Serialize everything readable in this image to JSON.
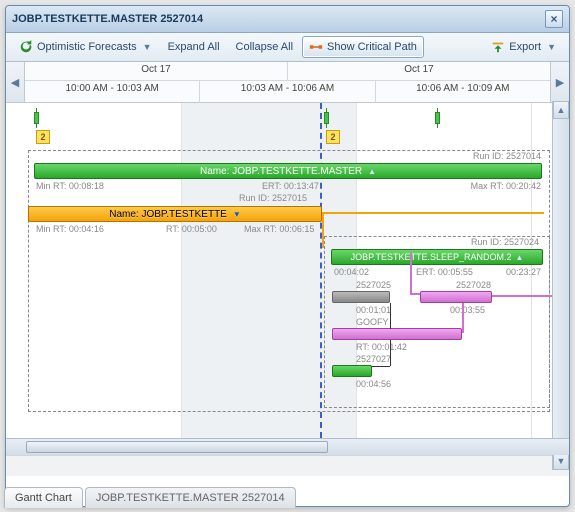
{
  "window": {
    "title": "JOBP.TESTKETTE.MASTER 2527014",
    "close_glyph": "×"
  },
  "toolbar": {
    "optimistic": "Optimistic Forecasts",
    "expand": "Expand All",
    "collapse": "Collapse All",
    "critical": "Show Critical Path",
    "export": "Export"
  },
  "timeline": {
    "top_left": "Oct 17",
    "top_right": "Oct 17",
    "range_left": "10:00 AM - 10:03 AM",
    "range_mid": "10:03 AM - 10:06 AM",
    "range_right": "10:06 AM - 10:09 AM",
    "nav_left": "◀",
    "nav_right": "▶"
  },
  "chart": {
    "badge1": "2",
    "badge2": "2",
    "green1_name": "Name: JOBP.TESTKETTE.MASTER",
    "green1_min": "Min RT: 00:08:18",
    "green1_ert": "ERT: 00:13:47",
    "green1_max": "Max RT: 00:20:42",
    "green1_runid": "Run ID: 2527015",
    "top_runid": "Run ID: 2527014",
    "orange_name": "Name: JOBP.TESTKETTE",
    "orange_min": "Min RT: 00:04:16",
    "orange_rt": "RT: 00:05:00",
    "orange_max": "Max RT: 00:06:15",
    "mid_runid": "Run ID: 2527024",
    "sleep_name": "JOBP.TESTKETTE.SLEEP_RANDOM.2",
    "sleep_t1": "00:04:02",
    "sleep_ert": "ERT: 00:05:55",
    "sleep_t2": "00:23:27",
    "id_25": "2527025",
    "t_0101": "00:01:01",
    "goofy": "GOOFY",
    "rt_0142": "RT: 00:01:42",
    "id_27": "2527027",
    "t_0456": "00:04:56",
    "id_28": "2527028",
    "t_0355": "00:03:55"
  },
  "tabs": {
    "gantt": "Gantt Chart",
    "master": "JOBP.TESTKETTE.MASTER 2527014"
  }
}
